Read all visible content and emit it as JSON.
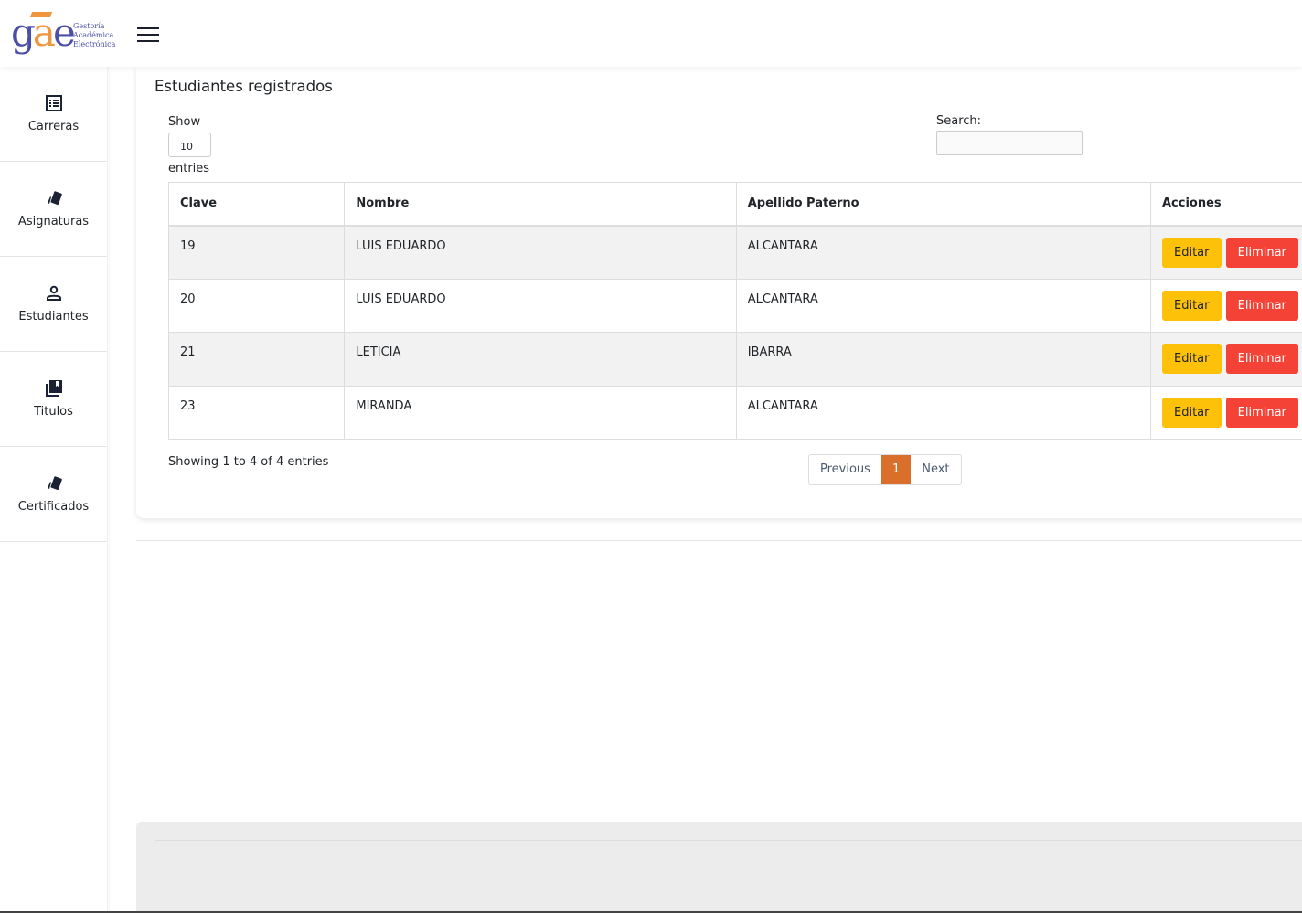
{
  "logo": {
    "mark": "gae",
    "lines": [
      "Gestoría",
      "Académica",
      "Electrónica"
    ]
  },
  "sidebar": {
    "items": [
      {
        "label": "Carreras",
        "icon": "list-icon"
      },
      {
        "label": "Asignaturas",
        "icon": "cards-icon"
      },
      {
        "label": "Estudiantes",
        "icon": "user-icon"
      },
      {
        "label": "Titulos",
        "icon": "library-books-icon"
      },
      {
        "label": "Certificados",
        "icon": "cards-icon"
      }
    ]
  },
  "main": {
    "title": "Estudiantes registrados",
    "show_label": "Show",
    "entries_value": "10",
    "entries_label": "entries",
    "search_label": "Search:",
    "search_value": "",
    "columns": [
      "Clave",
      "Nombre",
      "Apellido Paterno",
      "Acciones"
    ],
    "rows": [
      {
        "clave": "19",
        "nombre": "LUIS EDUARDO",
        "apellido": "ALCANTARA"
      },
      {
        "clave": "20",
        "nombre": "LUIS EDUARDO",
        "apellido": "ALCANTARA"
      },
      {
        "clave": "21",
        "nombre": "LETICIA",
        "apellido": "IBARRA"
      },
      {
        "clave": "23",
        "nombre": "MIRANDA",
        "apellido": "ALCANTARA"
      }
    ],
    "edit_label": "Editar",
    "delete_label": "Eliminar",
    "info": "Showing 1 to 4 of 4 entries",
    "pagination": {
      "previous": "Previous",
      "current": "1",
      "next": "Next"
    }
  },
  "colors": {
    "accent": "#d96f2a",
    "edit": "#fdc109",
    "delete": "#f44336"
  }
}
